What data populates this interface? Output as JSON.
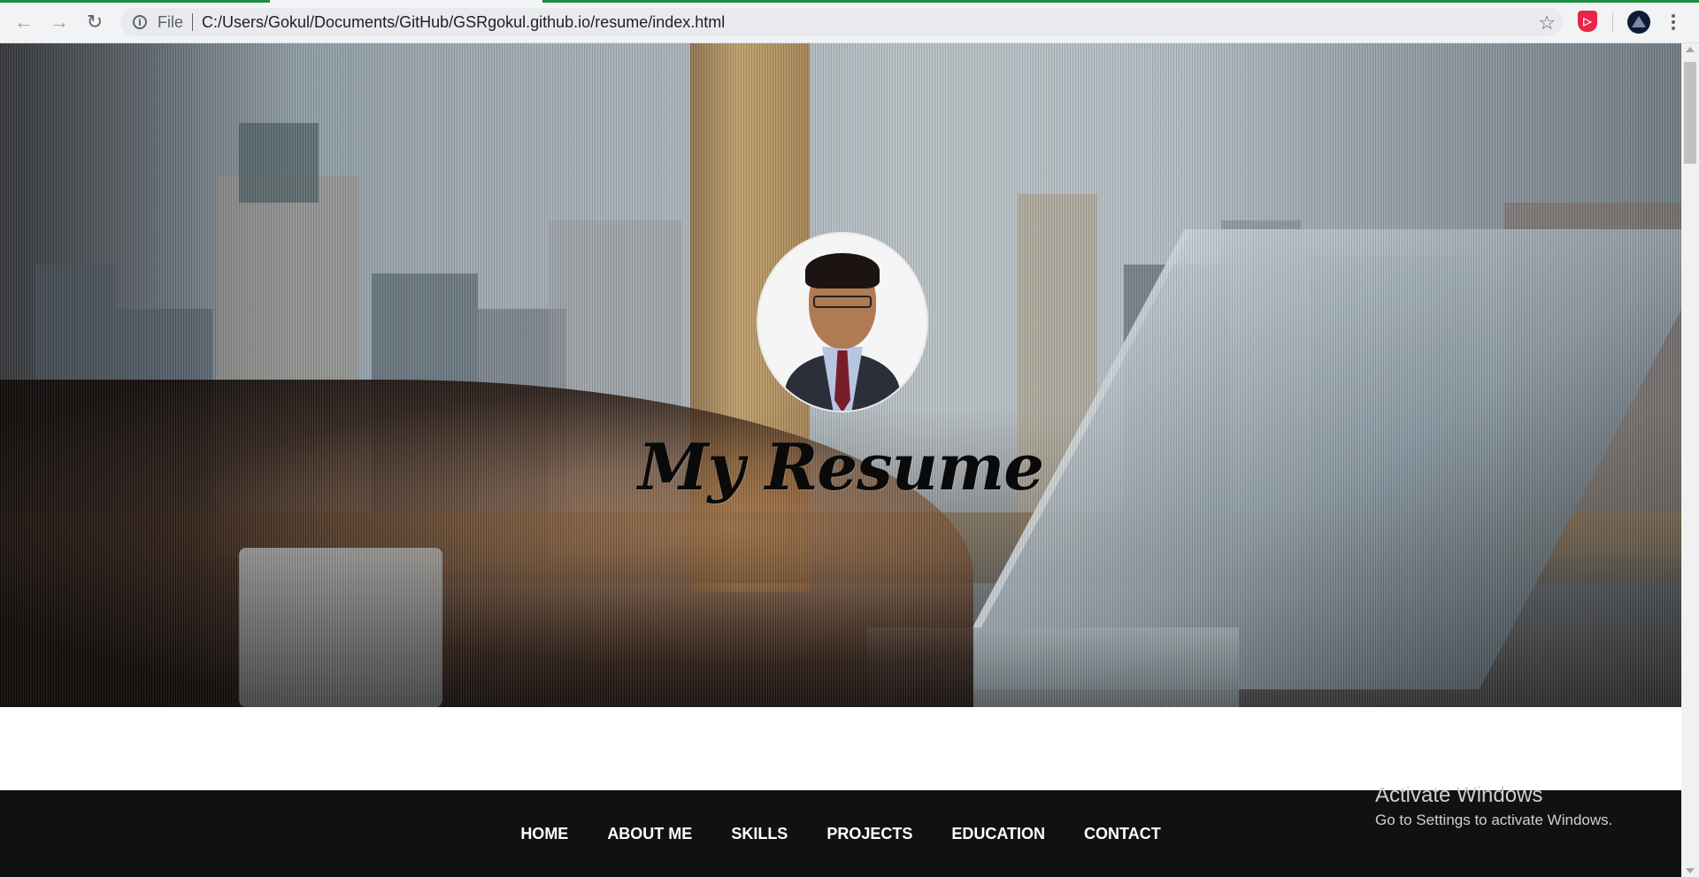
{
  "browser": {
    "scheme_label": "File",
    "url": "C:/Users/Gokul/Documents/GitHub/GSRgokul.github.io/resume/index.html",
    "icons": [
      "back-icon",
      "forward-icon",
      "reload-icon",
      "info-icon",
      "star-icon",
      "extension-icon",
      "profile-avatar-icon",
      "menu-icon"
    ],
    "accent_color": "#1e8e3e"
  },
  "hero": {
    "title": "My Resume",
    "profile_alt": "profile-photo"
  },
  "nav": {
    "items": [
      {
        "label": "HOME"
      },
      {
        "label": "ABOUT ME"
      },
      {
        "label": "SKILLS"
      },
      {
        "label": "PROJECTS"
      },
      {
        "label": "EDUCATION"
      },
      {
        "label": "CONTACT"
      }
    ]
  },
  "watermark": {
    "line1": "Activate Windows",
    "line2": "Go to Settings to activate Windows."
  }
}
